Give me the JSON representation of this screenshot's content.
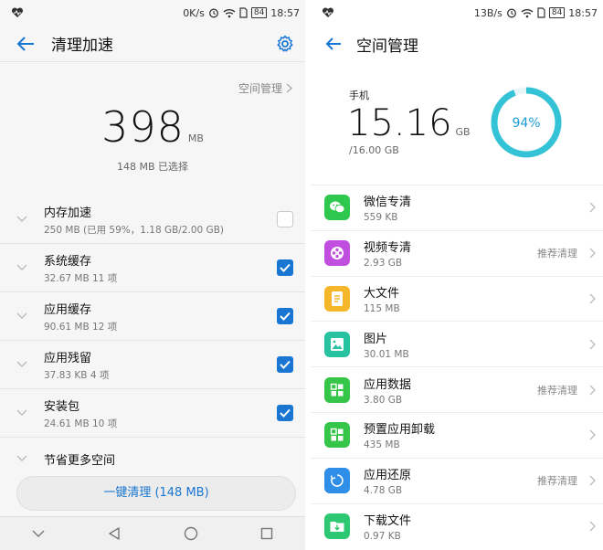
{
  "colors": {
    "accent": "#1976d2",
    "ring": "#34c3d6",
    "ring_track": "#e8f5f7"
  },
  "left": {
    "status": {
      "speed": "0K/s",
      "battery": "84",
      "time": "18:57"
    },
    "title": "清理加速",
    "space_link": "空间管理",
    "total": {
      "value": "398",
      "unit": "MB"
    },
    "selected_info": "148 MB 已选择",
    "rows": [
      {
        "title": "内存加速",
        "detail": "250 MB (已用 59%，1.18 GB/2.00 GB)",
        "checked": false
      },
      {
        "title": "系统缓存",
        "detail": "32.67 MB   11 项",
        "checked": true
      },
      {
        "title": "应用缓存",
        "detail": "90.61 MB   12 项",
        "checked": true
      },
      {
        "title": "应用残留",
        "detail": "37.83 KB   4 项",
        "checked": true
      },
      {
        "title": "安装包",
        "detail": "24.61 MB   10 项",
        "checked": true
      }
    ],
    "more_space": "节省更多空间",
    "clean_button": "一键清理 (148 MB)"
  },
  "right": {
    "status": {
      "speed": "13B/s",
      "battery": "84",
      "time": "18:57"
    },
    "title": "空间管理",
    "phone_label": "手机",
    "used": {
      "value": "15.16",
      "unit": "GB"
    },
    "total": "/16.00 GB",
    "percent_label": "94%",
    "percent": 94,
    "items": [
      {
        "name": "微信专清",
        "size": "559 KB",
        "tag": "",
        "color": "#2dc84d",
        "icon": "wechat-icon"
      },
      {
        "name": "视频专清",
        "size": "2.93 GB",
        "tag": "推荐清理",
        "color": "#c04fe0",
        "icon": "video-reel-icon"
      },
      {
        "name": "大文件",
        "size": "115 MB",
        "tag": "",
        "color": "#f6b629",
        "icon": "document-icon"
      },
      {
        "name": "图片",
        "size": "30.01 MB",
        "tag": "",
        "color": "#27c2a0",
        "icon": "picture-icon"
      },
      {
        "name": "应用数据",
        "size": "3.80 GB",
        "tag": "推荐清理",
        "color": "#35c548",
        "icon": "apps-grid-icon"
      },
      {
        "name": "预置应用卸载",
        "size": "435 MB",
        "tag": "",
        "color": "#35c548",
        "icon": "apps-grid-icon"
      },
      {
        "name": "应用还原",
        "size": "4.78 GB",
        "tag": "推荐清理",
        "color": "#2f8fe8",
        "icon": "restore-icon"
      },
      {
        "name": "下载文件",
        "size": "0.97 KB",
        "tag": "",
        "color": "#2dc871",
        "icon": "download-folder-icon"
      }
    ]
  }
}
